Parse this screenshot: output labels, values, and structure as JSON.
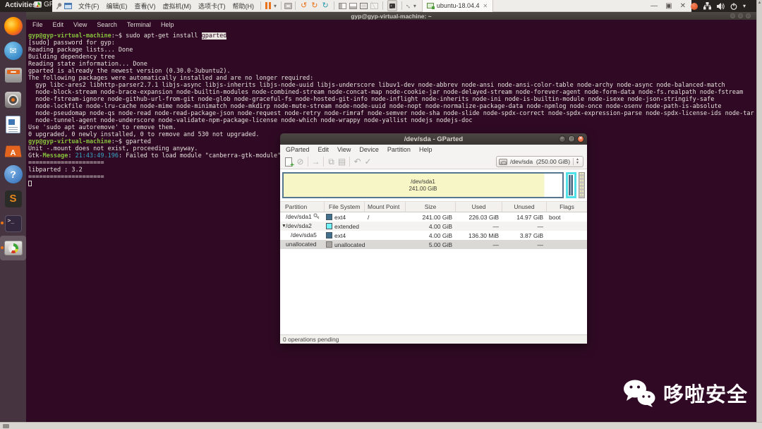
{
  "topbar": {
    "activities_label": "Activities",
    "app_name": "GParted",
    "vmware_menus": [
      "文件(F)",
      "编辑(E)",
      "查看(V)",
      "虚拟机(M)",
      "选项卡(T)",
      "帮助(H)"
    ],
    "tab_label": "ubuntu-18.04.4",
    "accent_orange": "#e95420"
  },
  "dock": {
    "items": [
      {
        "name": "firefox"
      },
      {
        "name": "thunderbird"
      },
      {
        "name": "files"
      },
      {
        "name": "rhythmbox"
      },
      {
        "name": "libreoffice-writer"
      },
      {
        "name": "ubuntu-software"
      },
      {
        "name": "help"
      },
      {
        "name": "sublime-text"
      },
      {
        "name": "terminal",
        "running": true
      },
      {
        "name": "gparted",
        "running": true,
        "active": true
      }
    ]
  },
  "terminal_window": {
    "title": "gyp@gyp-virtual-machine: ~",
    "menu": [
      "File",
      "Edit",
      "View",
      "Search",
      "Terminal",
      "Help"
    ],
    "colors": {
      "prompt_green": "#87c03d",
      "timestamp_blue": "#36a5c6"
    },
    "lines": [
      [
        [
          "gyp@gyp-virtual-machine",
          "p"
        ],
        [
          ":~$ sudo apt-get install ",
          "d"
        ],
        [
          "gparted",
          "s"
        ]
      ],
      "[sudo] password for gyp:",
      "Reading package lists... Done",
      "Building dependency tree",
      "Reading state information... Done",
      "gparted is already the newest version (0.30.0-3ubuntu2).",
      "The following packages were automatically installed and are no longer required:",
      "  gyp libc-ares2 libhttp-parser2.7.1 libjs-async libjs-inherits libjs-node-uuid libjs-underscore libuv1-dev node-abbrev node-ansi node-ansi-color-table node-archy node-async node-balanced-match",
      "  node-block-stream node-brace-expansion node-builtin-modules node-combined-stream node-concat-map node-cookie-jar node-delayed-stream node-forever-agent node-form-data node-fs.realpath node-fstream",
      "  node-fstream-ignore node-github-url-from-git node-glob node-graceful-fs node-hosted-git-info node-inflight node-inherits node-ini node-is-builtin-module node-isexe node-json-stringify-safe",
      "  node-lockfile node-lru-cache node-mime node-minimatch node-mkdirp node-mute-stream node-node-uuid node-nopt node-normalize-package-data node-npmlog node-once node-osenv node-path-is-absolute",
      "  node-pseudomap node-qs node-read node-read-package-json node-request node-retry node-rimraf node-semver node-sha node-slide node-spdx-correct node-spdx-expression-parse node-spdx-license-ids node-tar",
      "  node-tunnel-agent node-underscore node-validate-npm-package-license node-which node-wrappy node-yallist nodejs nodejs-doc",
      "Use 'sudo apt autoremove' to remove them.",
      "0 upgraded, 0 newly installed, 0 to remove and 530 not upgraded.",
      [
        [
          "gyp@gyp-virtual-machine",
          "p"
        ],
        [
          ":~$ gparted",
          "d"
        ]
      ],
      "Unit -.mount does not exist, proceeding anyway.",
      [
        [
          "Gtk-",
          "d"
        ],
        [
          "Message",
          "g"
        ],
        [
          ": ",
          "d"
        ],
        [
          "21:43:49.196",
          "t"
        ],
        [
          ": Failed to load module \"canberra-gtk-module\"",
          "d"
        ]
      ],
      "=====================",
      "libparted : 3.2",
      "=====================",
      [
        [
          "",
          "cur"
        ]
      ]
    ]
  },
  "gparted_window": {
    "title": "/dev/sda - GParted",
    "menu": [
      "GParted",
      "Edit",
      "View",
      "Device",
      "Partition",
      "Help"
    ],
    "device_combo": "/dev/sda  (250.00 GiB)",
    "visual": {
      "sda1_name": "/dev/sda1",
      "sda1_size": "241.00 GiB"
    },
    "table": {
      "headers": [
        "Partition",
        "File System",
        "Mount Point",
        "Size",
        "Used",
        "Unused",
        "Flags"
      ],
      "rows": [
        {
          "partition": "/dev/sda1",
          "has_key": true,
          "indent": 8,
          "fs": "ext4",
          "fs_color": "#41718f",
          "mount": "/",
          "size": "241.00 GiB",
          "used": "226.03 GiB",
          "unused": "14.97 GiB",
          "flags": "boot",
          "bg": "#ffffff"
        },
        {
          "partition": "/dev/sda2",
          "expander": true,
          "indent": 8,
          "fs": "extended",
          "fs_color": "#72f4f6",
          "mount": "",
          "size": "4.00 GiB",
          "used": "—",
          "unused": "—",
          "flags": "",
          "bg": "#f4f3f1"
        },
        {
          "partition": "/dev/sda5",
          "indent": 15,
          "fs": "ext4",
          "fs_color": "#41718f",
          "mount": "",
          "size": "4.00 GiB",
          "used": "136.30 MiB",
          "unused": "3.87 GiB",
          "flags": "",
          "bg": "#ffffff"
        },
        {
          "partition": "unallocated",
          "indent": 8,
          "fs": "unallocated",
          "fs_color": "#a8a5a2",
          "mount": "",
          "size": "5.00 GiB",
          "used": "—",
          "unused": "—",
          "flags": "",
          "bg": "#dbd9d6"
        }
      ]
    },
    "status_bar": "0 operations pending"
  },
  "watermark": {
    "text": "哆啦安全"
  }
}
